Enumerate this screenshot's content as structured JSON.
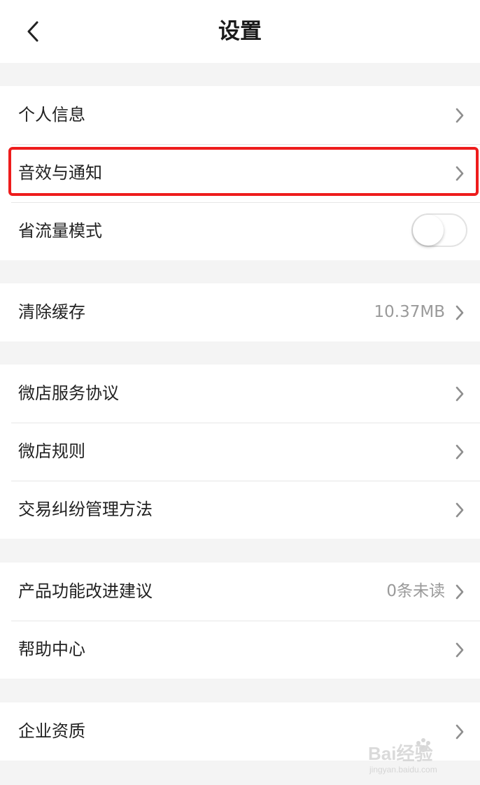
{
  "header": {
    "title": "设置"
  },
  "groups": [
    {
      "items": [
        {
          "label": "个人信息"
        },
        {
          "label": "音效与通知"
        },
        {
          "label": "省流量模式",
          "toggle_on": false
        }
      ]
    },
    {
      "items": [
        {
          "label": "清除缓存",
          "value": "10.37MB"
        }
      ]
    },
    {
      "items": [
        {
          "label": "微店服务协议"
        },
        {
          "label": "微店规则"
        },
        {
          "label": "交易纠纷管理方法"
        }
      ]
    },
    {
      "items": [
        {
          "label": "产品功能改进建议",
          "value": "0条未读"
        },
        {
          "label": "帮助中心"
        }
      ]
    },
    {
      "items": [
        {
          "label": "企业资质"
        }
      ]
    }
  ],
  "colors": {
    "highlight": "#ee1c1c",
    "value_text": "#9a9a9a",
    "background": "#f4f4f4"
  },
  "icons": [
    "back-arrow-icon",
    "chevron-right-icon"
  ],
  "watermark": {
    "brand": "Bai经验",
    "url": "jingyan.baidu.com"
  }
}
